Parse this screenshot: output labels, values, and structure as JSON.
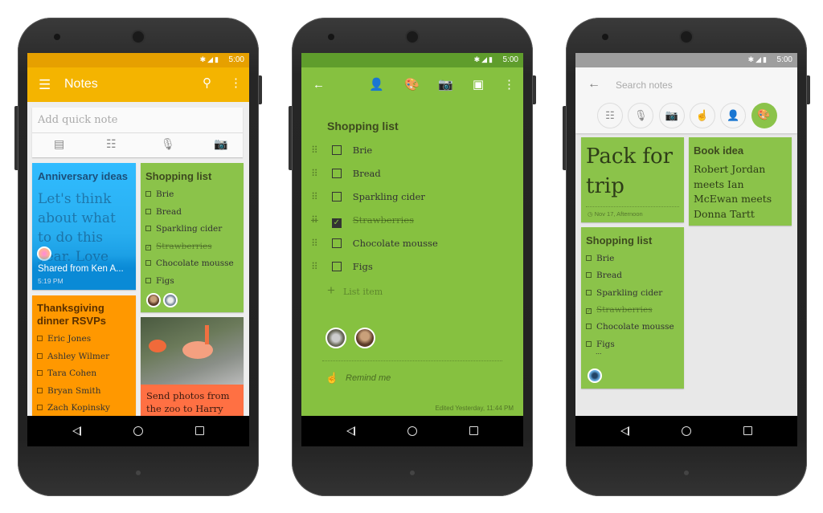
{
  "status": {
    "time": "5:00"
  },
  "colors": {
    "keep_yellow": "#f4b400",
    "keep_green": "#8bc34a",
    "blue": "#29b6f6",
    "orange": "#ff9800",
    "coral": "#ff7043"
  },
  "phone1": {
    "title": "Notes",
    "quick_note_placeholder": "Add quick note",
    "icons": [
      "menu-icon",
      "search-icon",
      "more-icon",
      "note-icon",
      "list-icon",
      "mic-icon",
      "camera-icon"
    ],
    "anniversary": {
      "title": "Anniversary ideas",
      "body": "Let's think about what to do this year. Love",
      "shared": "Shared from Ken A...",
      "time": "5:19 PM"
    },
    "shopping": {
      "title": "Shopping list",
      "items": [
        {
          "t": "Brie",
          "d": false
        },
        {
          "t": "Bread",
          "d": false
        },
        {
          "t": "Sparkling cider",
          "d": false
        },
        {
          "t": "Strawberries",
          "d": true
        },
        {
          "t": "Chocolate mousse",
          "d": false
        },
        {
          "t": "Figs",
          "d": false
        }
      ]
    },
    "thanksgiving": {
      "title": "Thanksgiving dinner RSVPs",
      "items": [
        {
          "t": "Eric Jones",
          "d": false
        },
        {
          "t": "Ashley Wilmer",
          "d": false
        },
        {
          "t": "Tara Cohen",
          "d": false
        },
        {
          "t": "Bryan Smith",
          "d": false
        },
        {
          "t": "Zach Kopinsky",
          "d": false
        }
      ]
    },
    "photo": {
      "text": "Send photos from the zoo to Harry"
    }
  },
  "phone2": {
    "title": "Shopping list",
    "icons": [
      "back-arrow-icon",
      "add-person-icon",
      "palette-icon",
      "camera-icon",
      "archive-icon",
      "more-icon"
    ],
    "items": [
      {
        "t": "Brie",
        "d": false
      },
      {
        "t": "Bread",
        "d": false
      },
      {
        "t": "Sparkling cider",
        "d": false
      },
      {
        "t": "Strawberries",
        "d": true
      },
      {
        "t": "Chocolate mousse",
        "d": false
      },
      {
        "t": "Figs",
        "d": false
      }
    ],
    "add_item": "List item",
    "remind": "Remind me",
    "edited": "Edited Yesterday, 11:44 PM"
  },
  "phone3": {
    "search_placeholder": "Search notes",
    "filters": [
      "list-icon",
      "mic-icon",
      "camera-icon",
      "touch-icon",
      "person-icon",
      "palette-icon"
    ],
    "pack": {
      "title": "Pack for trip",
      "reminder": "Nov 17, Afternoon"
    },
    "book": {
      "title": "Book idea",
      "body": "Robert Jordan meets Ian McEwan meets Donna Tartt"
    },
    "shopping": {
      "title": "Shopping list",
      "items": [
        {
          "t": "Brie",
          "d": false
        },
        {
          "t": "Bread",
          "d": false
        },
        {
          "t": "Sparkling cider",
          "d": false
        },
        {
          "t": "Strawberries",
          "d": true
        },
        {
          "t": "Chocolate mousse",
          "d": false
        },
        {
          "t": "Figs",
          "d": false
        }
      ],
      "more": "..."
    }
  }
}
